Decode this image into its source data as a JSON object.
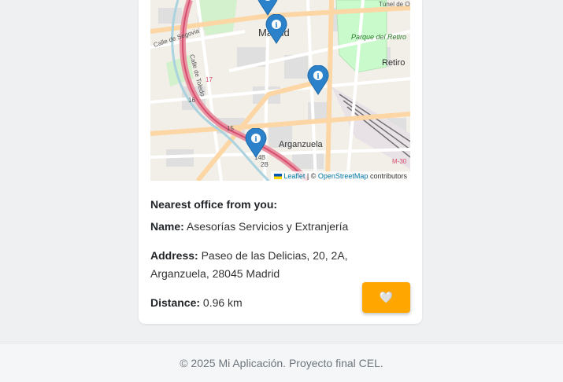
{
  "map": {
    "labels": {
      "city": "Madrid",
      "park": "Parque del Retiro",
      "district_retiro": "Retiro",
      "district_arganzuela": "Arganzuela",
      "street_segovia": "Calle de Segovia",
      "street_toledo": "Calle de Toledo",
      "tunnel": "Túnel de O'D",
      "road_a": "M-30",
      "num_16": "16",
      "num_17": "17",
      "num_15": "15",
      "num_14b": "14B",
      "num_2b": "2B"
    },
    "attribution": {
      "leaflet": "Leaflet",
      "separator": "| ©",
      "osm": "OpenStreetMap",
      "contributors": "contributors"
    },
    "marker_icon": "info-marker-icon",
    "colors": {
      "marker": "#2b82cb",
      "park": "#c8facc",
      "water": "#aad3df",
      "motorway": "#e892a2",
      "primary": "#fcd6a4"
    }
  },
  "office": {
    "heading": "Nearest office from you:",
    "name_label": "Name:",
    "name_value": "Asesorías Servicios y Extranjería",
    "address_label": "Address:",
    "address_value": "Paseo de las Delicias, 20, 2A, Arganzuela, 28045 Madrid",
    "distance_label": "Distance:",
    "distance_value": "0.96 km"
  },
  "favorite_button": {
    "icon": "heart-icon",
    "glyph": "🤍",
    "color": "#ffa600"
  },
  "footer": {
    "text": "© 2025 Mi Aplicación. Proyecto final CEL."
  }
}
